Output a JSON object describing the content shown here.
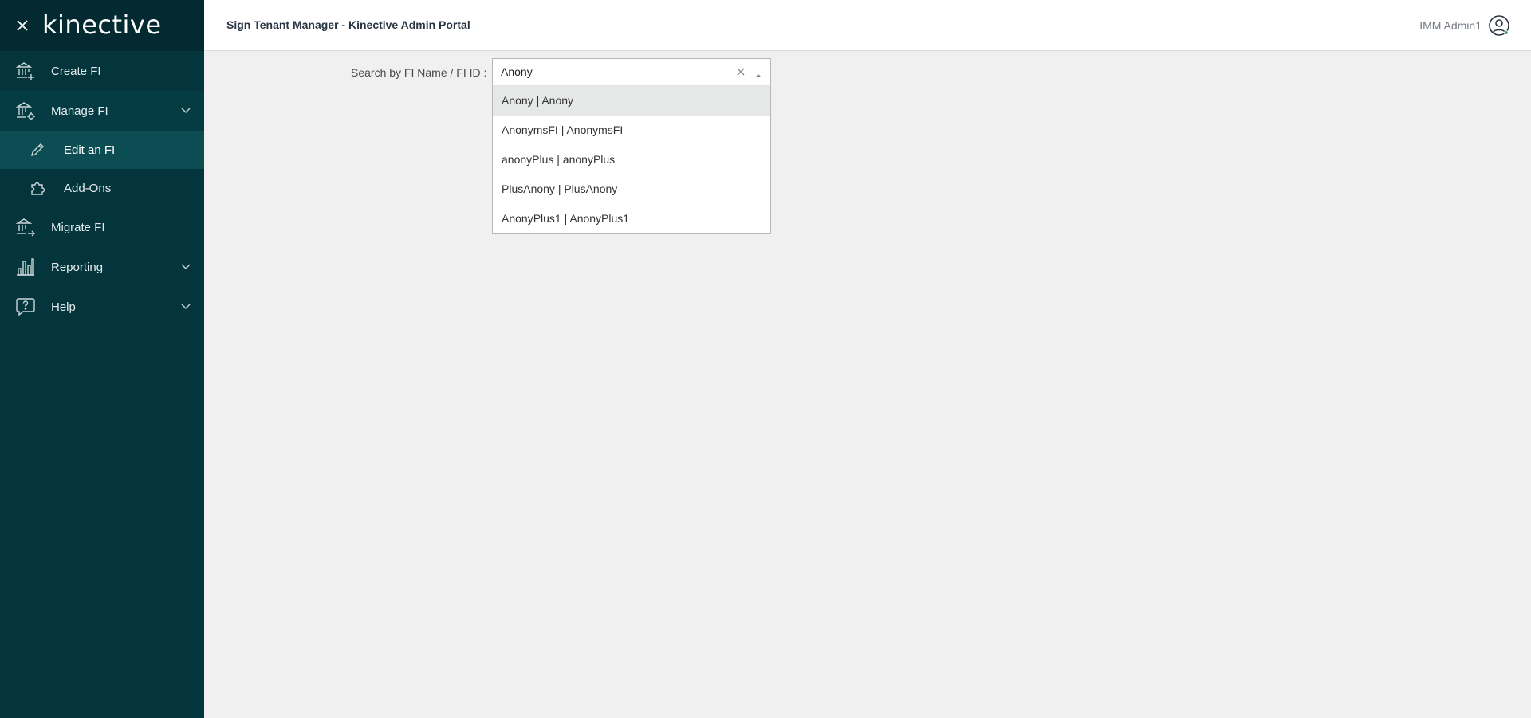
{
  "sidebar": {
    "brand": "kinective",
    "items": [
      {
        "label": "Create FI",
        "icon": "bank-add-icon"
      },
      {
        "label": "Manage FI",
        "icon": "bank-settings-icon",
        "expanded": true
      },
      {
        "label": "Edit an FI",
        "icon": "pencil-icon",
        "active": true
      },
      {
        "label": "Add-Ons",
        "icon": "puzzle-icon"
      },
      {
        "label": "Migrate FI",
        "icon": "bank-arrow-icon"
      },
      {
        "label": "Reporting",
        "icon": "bar-chart-icon",
        "expanded": false
      },
      {
        "label": "Help",
        "icon": "help-chat-icon",
        "expanded": false
      }
    ]
  },
  "header": {
    "title": "Sign Tenant Manager - Kinective Admin Portal",
    "user_name": "IMM Admin1"
  },
  "search": {
    "label": "Search by FI Name / FI ID :",
    "value": "Anony",
    "options": [
      "Anony | Anony",
      "AnonymsFI | AnonymsFI",
      "anonyPlus | anonyPlus",
      "PlusAnony | PlusAnony",
      "AnonyPlus1 | AnonyPlus1"
    ]
  },
  "colors": {
    "sidebar_bg": "#04353d",
    "sidebar_active": "#0c4c53",
    "content_bg": "#f0f0f0",
    "online_dot": "#2ea84a"
  }
}
